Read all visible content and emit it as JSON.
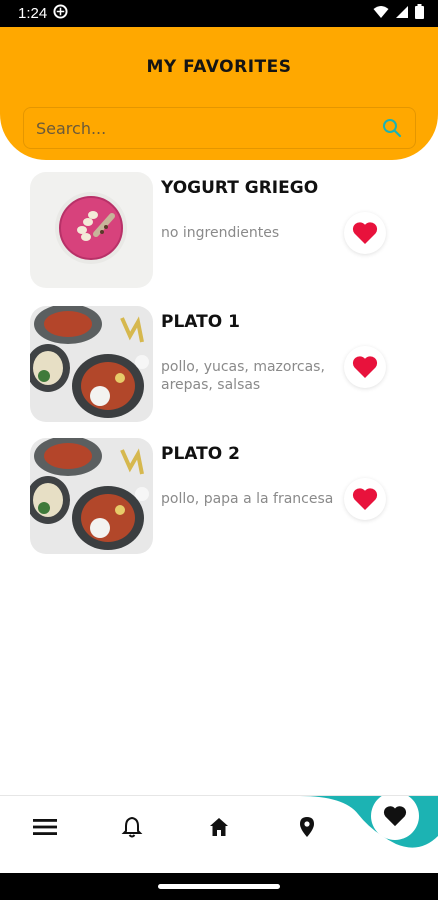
{
  "status_bar": {
    "time": "1:24"
  },
  "header": {
    "title": "MY FAVORITES"
  },
  "search": {
    "placeholder": "Search..."
  },
  "favorites": [
    {
      "title": "YOGURT GRIEGO",
      "description": "no ingrendientes",
      "image": "yogurt-bowl"
    },
    {
      "title": "PLATO 1",
      "description": "pollo, yucas, mazorcas, arepas, salsas",
      "image": "plates-dish"
    },
    {
      "title": "PLATO 2",
      "description": "pollo, papa a la francesa",
      "image": "plates-dish"
    }
  ],
  "bottom_nav": {
    "items": [
      "menu-icon",
      "bell-icon",
      "home-icon",
      "location-icon",
      "heart-icon"
    ],
    "active": "heart-icon"
  },
  "colors": {
    "header": "#FFA800",
    "heart": "#E8123C",
    "accent": "#1CB3B3"
  }
}
